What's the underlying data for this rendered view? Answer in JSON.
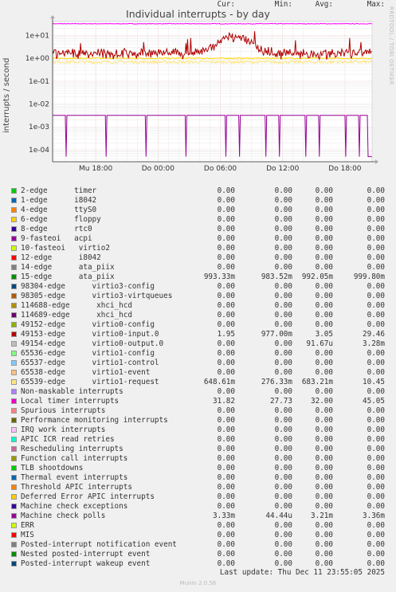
{
  "title": "Individual interrupts - by day",
  "side_text": "RRDTOOL / TOBI OETIKER",
  "ylabel": "interrupts / second",
  "table_header": {
    "cur": "Cur:",
    "min": "Min:",
    "avg": "Avg:",
    "max": "Max:"
  },
  "last_update": "Last update: Thu Dec 11 23:55:05 2025",
  "footer": "Munin 2.0.56",
  "chart_data": {
    "type": "line",
    "title": "Individual interrupts - by day",
    "ylabel": "interrupts / second",
    "yscale": "log",
    "ylim": [
      3e-05,
      40
    ],
    "yticks": [
      {
        "value": 10,
        "label": "1e+01"
      },
      {
        "value": 1,
        "label": "1e+00"
      },
      {
        "value": 0.1,
        "label": "1e-01"
      },
      {
        "value": 0.01,
        "label": "1e-02"
      },
      {
        "value": 0.001,
        "label": "1e-03"
      },
      {
        "value": 0.0001,
        "label": "1e-04"
      }
    ],
    "xticks": [
      {
        "frac": 0.135,
        "label": "Mu 18:00"
      },
      {
        "frac": 0.33,
        "label": "Do 00:00"
      },
      {
        "frac": 0.525,
        "label": "Do 06:00"
      },
      {
        "frac": 0.72,
        "label": "Do 12:00"
      },
      {
        "frac": 0.915,
        "label": "Do 18:00"
      }
    ],
    "grid": true,
    "series": [
      {
        "name": "Local timer interrupts",
        "color": "#ff00ff",
        "avg": 32.0,
        "noise": 0.03
      },
      {
        "name": "15-edge ata_piix",
        "color": "#ffd700",
        "avg": 0.992,
        "noise": 0.06
      },
      {
        "name": "65539-edge virtio1-request",
        "color": "#ffe680",
        "avg": 0.683,
        "noise": 0.15
      },
      {
        "name": "49153-edge virtio0-input.0",
        "color": "#b00000",
        "avg": 3.05,
        "noise": 0.25,
        "bump": true
      },
      {
        "name": "Machine check polls",
        "color": "#990099",
        "avg": 0.00321,
        "pattern": "drops"
      }
    ]
  },
  "legend": [
    {
      "label": "2-edge      timer",
      "color": "#00cc00",
      "cur": "0.00",
      "min": "0.00",
      "avg": "0.00",
      "max": "0.00"
    },
    {
      "label": "1-edge      i8042",
      "color": "#0066b3",
      "cur": "0.00",
      "min": "0.00",
      "avg": "0.00",
      "max": "0.00"
    },
    {
      "label": "4-edge      ttyS0",
      "color": "#ff8000",
      "cur": "0.00",
      "min": "0.00",
      "avg": "0.00",
      "max": "0.00"
    },
    {
      "label": "6-edge      floppy",
      "color": "#ffcc00",
      "cur": "0.00",
      "min": "0.00",
      "avg": "0.00",
      "max": "0.00"
    },
    {
      "label": "8-edge      rtc0",
      "color": "#330099",
      "cur": "0.00",
      "min": "0.00",
      "avg": "0.00",
      "max": "0.00"
    },
    {
      "label": "9-fasteoi   acpi",
      "color": "#990099",
      "cur": "0.00",
      "min": "0.00",
      "avg": "0.00",
      "max": "0.00"
    },
    {
      "label": "10-fasteoi   virtio2",
      "color": "#ccff00",
      "cur": "0.00",
      "min": "0.00",
      "avg": "0.00",
      "max": "0.00"
    },
    {
      "label": "12-edge      i8042",
      "color": "#ff0000",
      "cur": "0.00",
      "min": "0.00",
      "avg": "0.00",
      "max": "0.00"
    },
    {
      "label": "14-edge      ata_piix",
      "color": "#808080",
      "cur": "0.00",
      "min": "0.00",
      "avg": "0.00",
      "max": "0.00"
    },
    {
      "label": "15-edge      ata_piix",
      "color": "#008f00",
      "cur": "993.33m",
      "min": "983.52m",
      "avg": "992.05m",
      "max": "999.80m"
    },
    {
      "label": "98304-edge      virtio3-config",
      "color": "#00487d",
      "cur": "0.00",
      "min": "0.00",
      "avg": "0.00",
      "max": "0.00"
    },
    {
      "label": "98305-edge      virtio3-virtqueues",
      "color": "#b35a00",
      "cur": "0.00",
      "min": "0.00",
      "avg": "0.00",
      "max": "0.00"
    },
    {
      "label": "114688-edge      xhci_hcd",
      "color": "#b38f00",
      "cur": "0.00",
      "min": "0.00",
      "avg": "0.00",
      "max": "0.00"
    },
    {
      "label": "114689-edge      xhci_hcd",
      "color": "#6b006b",
      "cur": "0.00",
      "min": "0.00",
      "avg": "0.00",
      "max": "0.00"
    },
    {
      "label": "49152-edge      virtio0-config",
      "color": "#8fb300",
      "cur": "0.00",
      "min": "0.00",
      "avg": "0.00",
      "max": "0.00"
    },
    {
      "label": "49153-edge      virtio0-input.0",
      "color": "#b30000",
      "cur": "1.95",
      "min": "977.00m",
      "avg": "3.05",
      "max": "29.46"
    },
    {
      "label": "49154-edge      virtio0-output.0",
      "color": "#bebebe",
      "cur": "0.00",
      "min": "0.00",
      "avg": "91.67u",
      "max": "3.28m"
    },
    {
      "label": "65536-edge      virtio1-config",
      "color": "#80ff80",
      "cur": "0.00",
      "min": "0.00",
      "avg": "0.00",
      "max": "0.00"
    },
    {
      "label": "65537-edge      virtio1-control",
      "color": "#80c9ff",
      "cur": "0.00",
      "min": "0.00",
      "avg": "0.00",
      "max": "0.00"
    },
    {
      "label": "65538-edge      virtio1-event",
      "color": "#ffc080",
      "cur": "0.00",
      "min": "0.00",
      "avg": "0.00",
      "max": "0.00"
    },
    {
      "label": "65539-edge      virtio1-request",
      "color": "#ffe680",
      "cur": "648.61m",
      "min": "276.33m",
      "avg": "683.21m",
      "max": "10.45"
    },
    {
      "label": "Non-maskable interrupts",
      "color": "#aa80ff",
      "cur": "0.00",
      "min": "0.00",
      "avg": "0.00",
      "max": "0.00"
    },
    {
      "label": "Local timer interrupts",
      "color": "#ee00cc",
      "cur": "31.82",
      "min": "27.73",
      "avg": "32.00",
      "max": "45.05"
    },
    {
      "label": "Spurious interrupts",
      "color": "#ff8080",
      "cur": "0.00",
      "min": "0.00",
      "avg": "0.00",
      "max": "0.00"
    },
    {
      "label": "Performance monitoring interrupts",
      "color": "#666600",
      "cur": "0.00",
      "min": "0.00",
      "avg": "0.00",
      "max": "0.00"
    },
    {
      "label": "IRQ work interrupts",
      "color": "#ffbfff",
      "cur": "0.00",
      "min": "0.00",
      "avg": "0.00",
      "max": "0.00"
    },
    {
      "label": "APIC ICR read retries",
      "color": "#00ffcc",
      "cur": "0.00",
      "min": "0.00",
      "avg": "0.00",
      "max": "0.00"
    },
    {
      "label": "Rescheduling interrupts",
      "color": "#cc6699",
      "cur": "0.00",
      "min": "0.00",
      "avg": "0.00",
      "max": "0.00"
    },
    {
      "label": "Function call interrupts",
      "color": "#999900",
      "cur": "0.00",
      "min": "0.00",
      "avg": "0.00",
      "max": "0.00"
    },
    {
      "label": "TLB shootdowns",
      "color": "#00cc00",
      "cur": "0.00",
      "min": "0.00",
      "avg": "0.00",
      "max": "0.00"
    },
    {
      "label": "Thermal event interrupts",
      "color": "#0066b3",
      "cur": "0.00",
      "min": "0.00",
      "avg": "0.00",
      "max": "0.00"
    },
    {
      "label": "Threshold APIC interrupts",
      "color": "#ff8000",
      "cur": "0.00",
      "min": "0.00",
      "avg": "0.00",
      "max": "0.00"
    },
    {
      "label": "Deferred Error APIC interrupts",
      "color": "#ffcc00",
      "cur": "0.00",
      "min": "0.00",
      "avg": "0.00",
      "max": "0.00"
    },
    {
      "label": "Machine check exceptions",
      "color": "#330099",
      "cur": "0.00",
      "min": "0.00",
      "avg": "0.00",
      "max": "0.00"
    },
    {
      "label": "Machine check polls",
      "color": "#990099",
      "cur": "3.33m",
      "min": "44.44u",
      "avg": "3.21m",
      "max": "3.36m"
    },
    {
      "label": "ERR",
      "color": "#ccff00",
      "cur": "0.00",
      "min": "0.00",
      "avg": "0.00",
      "max": "0.00"
    },
    {
      "label": "MIS",
      "color": "#ff0000",
      "cur": "0.00",
      "min": "0.00",
      "avg": "0.00",
      "max": "0.00"
    },
    {
      "label": "Posted-interrupt notification event",
      "color": "#808080",
      "cur": "0.00",
      "min": "0.00",
      "avg": "0.00",
      "max": "0.00"
    },
    {
      "label": "Nested posted-interrupt event",
      "color": "#008f00",
      "cur": "0.00",
      "min": "0.00",
      "avg": "0.00",
      "max": "0.00"
    },
    {
      "label": "Posted-interrupt wakeup event",
      "color": "#00487d",
      "cur": "0.00",
      "min": "0.00",
      "avg": "0.00",
      "max": "0.00"
    }
  ]
}
